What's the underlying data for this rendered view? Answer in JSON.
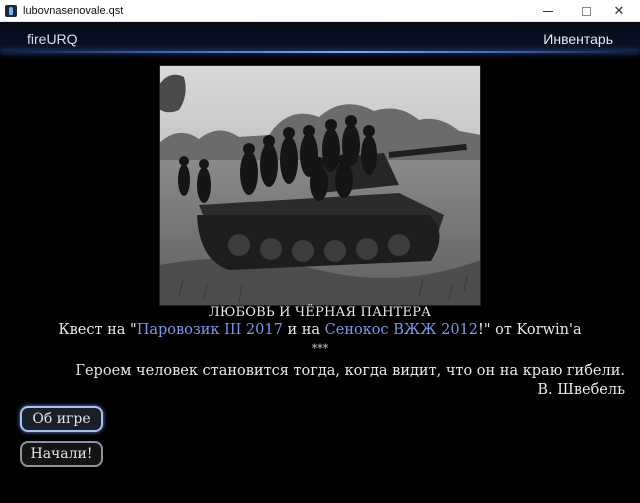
{
  "window": {
    "title": "lubovnasenovale.qst",
    "controls": {
      "minimize_icon": "minimize-icon",
      "maximize_icon": "maximize-icon",
      "close_icon": "close-icon",
      "close_glyph": "✕"
    }
  },
  "header": {
    "brand": "fireURQ",
    "inventory_label": "Инвентарь",
    "glow_color": "#7ea6ff"
  },
  "illustration": {
    "subject": "black-and-white photo of soldiers riding on a tank"
  },
  "story": {
    "title": "ЛЮБОВЬ И ЧЁРНАЯ ПАНТЕРА",
    "quest_prefix": "Квест на \"",
    "quest_link1": "Паровозик III 2017",
    "quest_middle": " и на ",
    "quest_link2": "Сенокос ВЖЖ 2012",
    "quest_suffix": "!\" от Korwin'a",
    "link_color": "#7b96ea",
    "separator": "***",
    "quote": "Героем человек становится тогда, когда видит, что он на краю гибели.",
    "author": "В. Швебель"
  },
  "actions": [
    {
      "label": "Об игре",
      "highlighted": true
    },
    {
      "label": "Начали!",
      "highlighted": false
    }
  ]
}
